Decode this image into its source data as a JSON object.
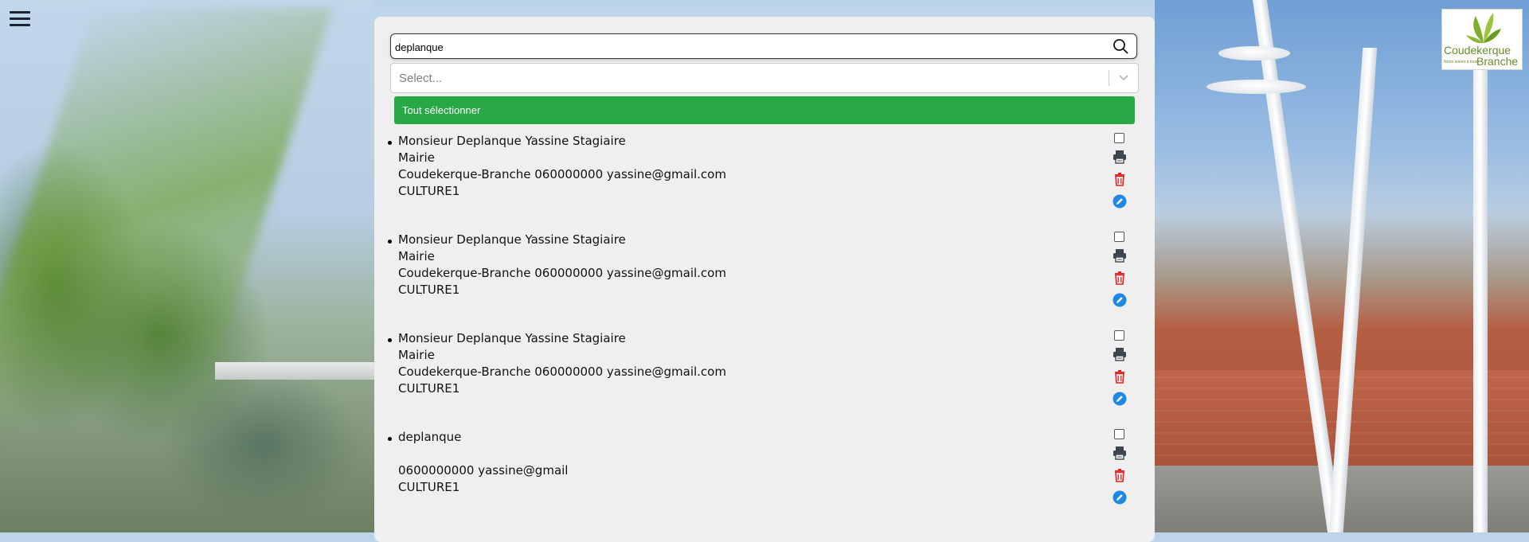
{
  "search": {
    "value": "deplanque"
  },
  "select": {
    "placeholder": "Select..."
  },
  "select_all_label": "Tout sélectionner",
  "logo": {
    "line1": "Coudekerque",
    "line2": "Branche",
    "tagline": "Notre avenir à tous"
  },
  "results": [
    {
      "line1": "Monsieur Deplanque Yassine Stagiaire",
      "line2": "Mairie",
      "line3": "Coudekerque-Branche 060000000 yassine@gmail.com",
      "line4": "CULTURE1"
    },
    {
      "line1": "Monsieur Deplanque Yassine Stagiaire",
      "line2": "Mairie",
      "line3": "Coudekerque-Branche 060000000 yassine@gmail.com",
      "line4": "CULTURE1"
    },
    {
      "line1": "Monsieur Deplanque Yassine Stagiaire",
      "line2": "Mairie",
      "line3": "Coudekerque-Branche 060000000 yassine@gmail.com",
      "line4": "CULTURE1"
    },
    {
      "line1": "deplanque",
      "line2": "",
      "line3": "0600000000 yassine@gmail",
      "line4": "CULTURE1"
    }
  ],
  "colors": {
    "select_all_bg": "#28a745",
    "delete": "#e02424",
    "edit": "#1e88e5",
    "print": "#3d4550"
  },
  "icons": {
    "menu": "hamburger-icon",
    "search": "search-icon",
    "dropdown": "chevron-down-icon",
    "checkbox": "checkbox-icon",
    "print": "printer-icon",
    "delete": "trash-icon",
    "edit": "pencil-icon"
  }
}
